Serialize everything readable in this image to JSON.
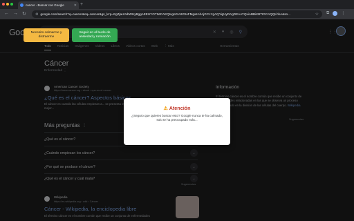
{
  "browser": {
    "tab_title": "cancer - Buscar con Google",
    "new_tab": "+",
    "url": "google.com/search?q=cancer&oq=cancer&gs_lcrp=EgZjaHJvbWUyBggAEEUYOTIMCAEQIxgnGIAEGIoFMgwIAhAjGCcYgAQYigUyDAgDEAAYQxiABBiKBTIGCAQQLhhA&so..."
  },
  "search": {
    "logo": "Google",
    "query": "cancer"
  },
  "tabs": [
    "Todo",
    "Noticias",
    "Imágenes",
    "Videos",
    "Libros",
    "Videos cortos",
    "Web",
    "⋮ Más"
  ],
  "tools_label": "Herramientas",
  "knowledge": {
    "title": "Cáncer",
    "subtitle": "Enfermedad ⋮"
  },
  "result1": {
    "site": "American Cancer Society",
    "url": "https://www.cancer.org › about › que-es-el-cancer",
    "title": "¿Qué es el cáncer? Aspectos básicos...",
    "snippet": "El cáncer es cuando las células empiezan a... se presenta información para entender y definir mejor..."
  },
  "paa": {
    "title": "Más preguntas",
    "dots": "⋮",
    "questions": [
      "¿Qué es el cáncer?",
      "¿Cuándo empiezan los cáncer?",
      "¿Por qué se produce el cáncer?",
      "¿Qué es el cáncer y cuál mata?"
    ],
    "feedback": "Sugerencias"
  },
  "result2": {
    "site": "Wikipedia",
    "url": "https://es.wikipedia.org › wiki › Cáncer",
    "title": "Cáncer - Wikipedia, la enciclopedia libre",
    "snippet": "El término cáncer es el nombre común que recibe un conjunto de enfermedades"
  },
  "info_panel": {
    "title": "Información",
    "text": "El término cáncer es el nombre común que recibe un conjunto de enfermedades relacionadas en las que se observa un proceso descontrolado en la división de las células del cuerpo.",
    "wiki": "Wikipedia",
    "feedback": "Sugerencias"
  },
  "dialog": {
    "icon": "⚠",
    "title": "Atención",
    "message": "¿Seguro que quieres buscar esto? Google nunca te ha calmado, solo te ha preocupado más...",
    "calm_button": "Necesito calmarme y distraerme",
    "search_button": "Seguir en el bucle de ansiedad y rumiación"
  }
}
